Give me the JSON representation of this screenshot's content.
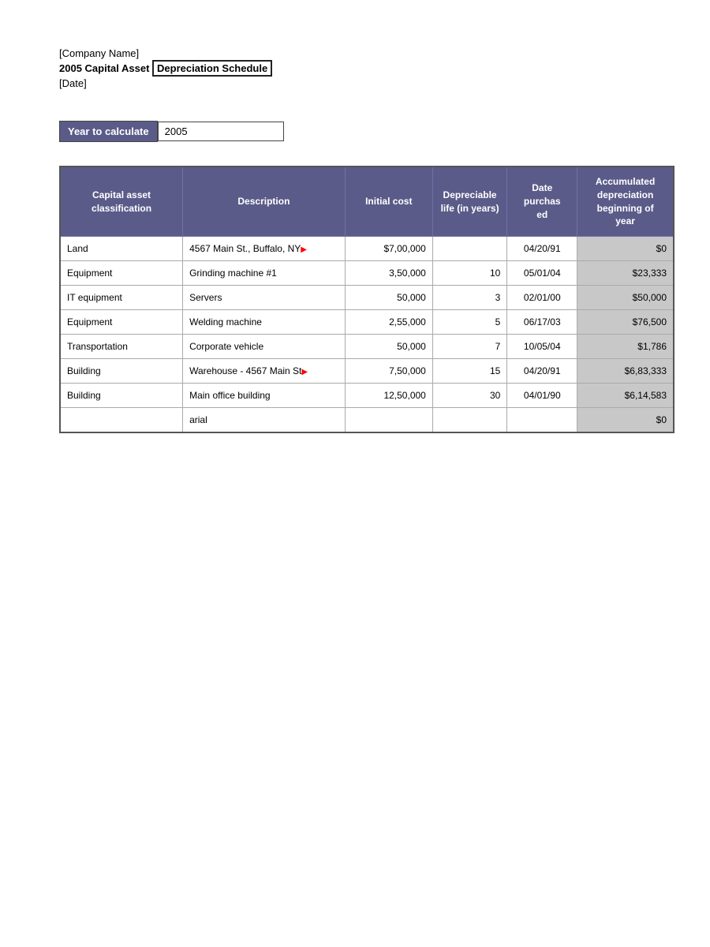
{
  "header": {
    "company_name": "[Company Name]",
    "title_part1": "2005 Capital Asset",
    "title_part2": "Depreciation Schedule",
    "date_label": "[Date]"
  },
  "year_section": {
    "label": "Year to calculate",
    "value": "2005"
  },
  "table": {
    "columns": [
      "Capital asset classification",
      "Description",
      "Initial cost",
      "Depreciable life (in years)",
      "Date purchased",
      "Accumulated depreciation beginning of year"
    ],
    "rows": [
      {
        "classification": "Land",
        "description": "4567 Main St., Buffalo, NY",
        "initial_cost": "$7,00,000",
        "life": "",
        "date_purchased": "04/20/91",
        "accum_depreciation": "$0"
      },
      {
        "classification": "Equipment",
        "description": "Grinding machine #1",
        "initial_cost": "3,50,000",
        "life": "10",
        "date_purchased": "05/01/04",
        "accum_depreciation": "$23,333"
      },
      {
        "classification": "IT equipment",
        "description": "Servers",
        "initial_cost": "50,000",
        "life": "3",
        "date_purchased": "02/01/00",
        "accum_depreciation": "$50,000"
      },
      {
        "classification": "Equipment",
        "description": "Welding machine",
        "initial_cost": "2,55,000",
        "life": "5",
        "date_purchased": "06/17/03",
        "accum_depreciation": "$76,500"
      },
      {
        "classification": "Transportation",
        "description": "Corporate vehicle",
        "initial_cost": "50,000",
        "life": "7",
        "date_purchased": "10/05/04",
        "accum_depreciation": "$1,786"
      },
      {
        "classification": "Building",
        "description": "Warehouse - 4567 Main St",
        "initial_cost": "7,50,000",
        "life": "15",
        "date_purchased": "04/20/91",
        "accum_depreciation": "$6,83,333"
      },
      {
        "classification": "Building",
        "description": "Main office building",
        "initial_cost": "12,50,000",
        "life": "30",
        "date_purchased": "04/01/90",
        "accum_depreciation": "$6,14,583"
      },
      {
        "classification": "",
        "description": "arial",
        "initial_cost": "",
        "life": "",
        "date_purchased": "",
        "accum_depreciation": "$0"
      }
    ]
  }
}
